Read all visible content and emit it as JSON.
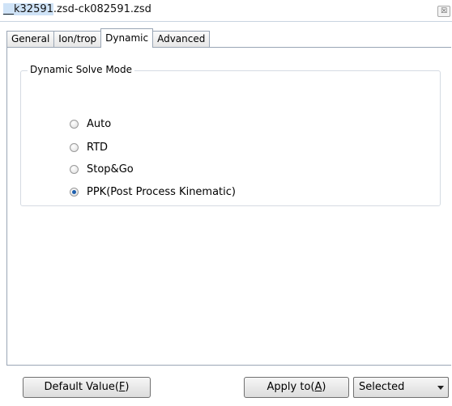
{
  "window": {
    "title_highlight": "__k32591",
    "title_rest": ".zsd-ck082591.zsd",
    "close_glyph": "☒"
  },
  "tabs": [
    {
      "label": "General",
      "active": false
    },
    {
      "label": "Ion/trop",
      "active": false
    },
    {
      "label": "Dynamic",
      "active": true
    },
    {
      "label": "Advanced",
      "active": false
    }
  ],
  "dynamic": {
    "group_title": "Dynamic Solve Mode",
    "options": [
      {
        "label": "Auto",
        "checked": false
      },
      {
        "label": "RTD",
        "checked": false
      },
      {
        "label": "Stop&Go",
        "checked": false
      },
      {
        "label": "PPK(Post Process Kinematic)",
        "checked": true
      }
    ]
  },
  "footer": {
    "default_btn": {
      "text": "Default Value(",
      "mnemonic": "F",
      "end": ")"
    },
    "apply_btn": {
      "text": "Apply to(",
      "mnemonic": "A",
      "end": ")"
    },
    "apply_select_value": "Selected"
  }
}
